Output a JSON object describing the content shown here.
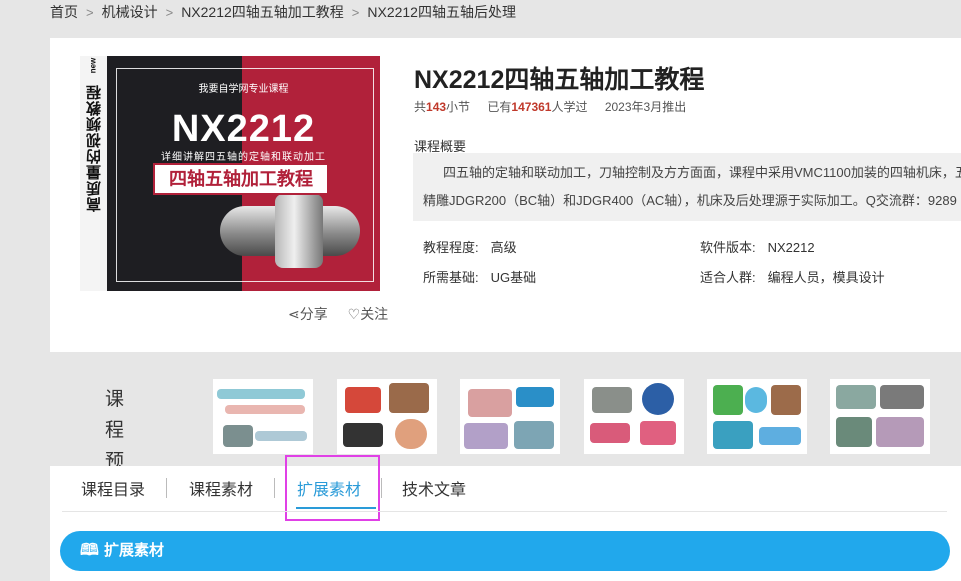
{
  "breadcrumb": [
    "首页",
    "机械设计",
    "NX2212四轴五轴加工教程",
    "NX2212四轴五轴后处理"
  ],
  "cover": {
    "top_text": "我要自学网专业课程",
    "big_title": "NX2212",
    "subtitle": "详细讲解四五轴的定轴和联动加工",
    "banner": "四轴五轴加工教程",
    "side_text": "高质量的视频教程",
    "side_new": "new"
  },
  "actions": {
    "share": "分享",
    "follow": "关注",
    "share_icon": "share-icon",
    "follow_icon": "heart-icon"
  },
  "course": {
    "title": "NX2212四轴五轴加工教程",
    "meta_prefix": "共",
    "lessons": "143",
    "lessons_suffix": "小节",
    "learners_prefix": "已有",
    "learners": "147361",
    "learners_suffix": "人学过",
    "release": "2023年3月推出",
    "overview_label": "课程概要",
    "overview_line1": "四五轴的定轴和联动加工，刀轴控制及方方面面，课程中采用VMC1100加装的四轴机床，五",
    "overview_line2": "精雕JDGR200（BC轴）和JDGR400（AC轴），机床及后处理源于实际加工。Q交流群：9289"
  },
  "info": {
    "level_label": "教程程度:",
    "level": "高级",
    "version_label": "软件版本:",
    "version": "NX2212",
    "basis_label": "所需基础:",
    "basis": "UG基础",
    "audience_label": "适合人群:",
    "audience": "编程人员，模具设计"
  },
  "preview": {
    "label": "课 程 预 览",
    "thumbs": 6
  },
  "tabs": [
    "课程目录",
    "课程素材",
    "扩展素材",
    "技术文章"
  ],
  "active_tab": "扩展素材",
  "section_bar": {
    "label": "扩展素材",
    "icon": "book-icon"
  },
  "colors": {
    "accent": "#21a8ec",
    "tab_active": "#2a9bd8",
    "highlight": "#e040e6",
    "stat": "#c0392b",
    "cover_red": "#b1213a"
  }
}
